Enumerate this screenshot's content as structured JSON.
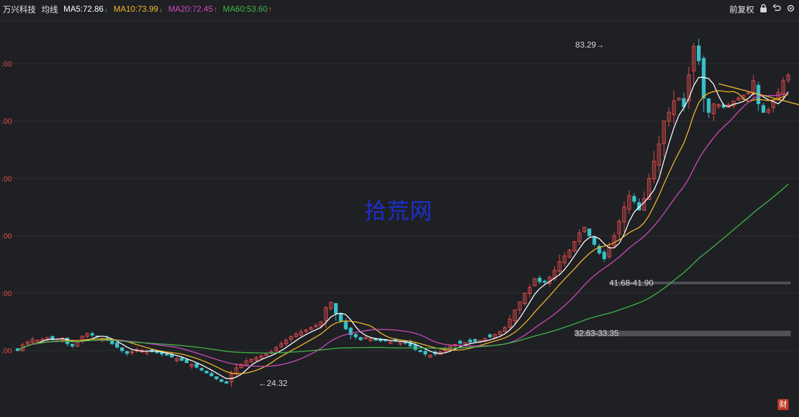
{
  "header": {
    "stock_name": "万兴科技",
    "ma_label": "均线",
    "ma5": "MA5:72.86",
    "ma10": "MA10:73.99",
    "ma20": "MA20:72.45",
    "ma60": "MA60:53.60",
    "ma5_arrow": "↓",
    "ma10_arrow": "↓",
    "ma20_arrow": "↑",
    "ma60_arrow": "↑",
    "adjust_label": "前复权"
  },
  "colors": {
    "up": "#e04b4b",
    "down": "#38c1c9",
    "ma5": "#ffffff",
    "ma10": "#f0b82a",
    "ma20": "#d04ac0",
    "ma60": "#3fb94a",
    "grid": "#2c2d31",
    "axis_text": "#e04b4b"
  },
  "watermark": "拾荒网",
  "badge": "财",
  "chart_data": {
    "type": "candlestick",
    "ylim": [
      20,
      87
    ],
    "y_ticks": [
      {
        "value": 30,
        "label": ".00"
      },
      {
        "value": 40,
        "label": ".00"
      },
      {
        "value": 50,
        "label": ".00"
      },
      {
        "value": 60,
        "label": ".00"
      },
      {
        "value": 70,
        "label": ".00"
      },
      {
        "value": 80,
        "label": ".00"
      }
    ],
    "annotations": [
      {
        "text": "83.29→",
        "x": 118,
        "y": 83.29
      },
      {
        "text": "←24.32",
        "x": 49,
        "y": 24.32
      },
      {
        "text": "41.68-41.90",
        "x": 119,
        "y": 41.8
      },
      {
        "text": "32.63-33.35",
        "x": 112,
        "y": 33.0
      }
    ],
    "support_bands": [
      {
        "low": 41.68,
        "high": 41.9,
        "x_start": 119
      },
      {
        "low": 32.63,
        "high": 33.35,
        "x_start": 112
      }
    ],
    "trendline": {
      "x1": 141,
      "y1": 76.5,
      "x2": 160,
      "y2": 72.2
    },
    "closes": [
      30,
      31,
      31.5,
      32,
      31.8,
      32,
      32.3,
      31.9,
      32,
      32.2,
      31.2,
      30.8,
      31.5,
      32.5,
      33,
      32.7,
      32.4,
      32.1,
      31.8,
      31.2,
      30.6,
      30,
      29.5,
      29.8,
      30.2,
      30.1,
      29.9,
      29.8,
      29.6,
      29.4,
      29.2,
      28.9,
      28.6,
      28.3,
      27.9,
      27.6,
      27.1,
      26.6,
      26.1,
      25.6,
      25.1,
      24.6,
      24.32,
      26,
      27,
      27.6,
      28.2,
      28.5,
      28.8,
      29.1,
      29.4,
      29.8,
      30.5,
      31.2,
      31.8,
      32.4,
      32.9,
      33.3,
      33.6,
      34,
      34.4,
      35,
      37.5,
      38.4,
      36.5,
      35.2,
      33.8,
      32.8,
      32.4,
      31.9,
      32.3,
      32.1,
      31.8,
      31.7,
      31.7,
      31.6,
      31.7,
      31.5,
      31.3,
      30.8,
      30.2,
      29.8,
      29.4,
      29.2,
      29.4,
      29.8,
      30.3,
      30.8,
      31.1,
      31.3,
      31.4,
      31.5,
      31.6,
      31.8,
      32.1,
      32.4,
      32.8,
      33.3,
      34,
      35.5,
      37.1,
      38.5,
      40,
      41,
      42.5,
      42,
      41.9,
      42.8,
      44,
      45.5,
      46.5,
      47.5,
      49,
      50.5,
      51.5,
      50,
      48.5,
      47,
      46,
      48,
      50,
      52.5,
      55,
      57,
      56,
      54.5,
      56.5,
      60,
      63,
      66,
      70,
      71.5,
      73.5,
      74,
      72.5,
      78,
      83,
      80.5,
      74,
      71.5,
      73,
      72.9,
      72.4,
      72.8,
      73.5,
      74,
      74.5,
      75,
      77,
      73,
      71.5,
      72,
      73.5,
      75,
      77,
      78
    ],
    "ma_series": [
      {
        "name": "MA5",
        "color": "#ffffff"
      },
      {
        "name": "MA10",
        "color": "#f0b82a"
      },
      {
        "name": "MA20",
        "color": "#d04ac0"
      },
      {
        "name": "MA60",
        "color": "#3fb94a"
      }
    ]
  }
}
